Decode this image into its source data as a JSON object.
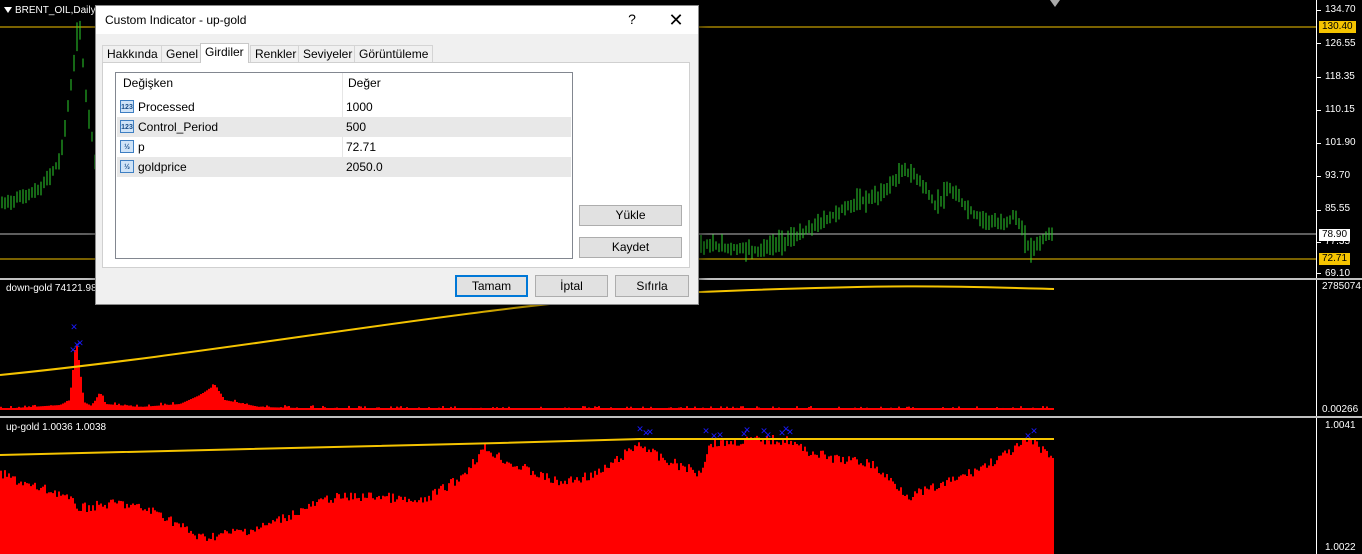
{
  "chart": {
    "symbol_label": "BRENT_OIL,Daily",
    "price_scale": [
      "134.70",
      "126.55",
      "118.35",
      "110.15",
      "101.90",
      "93.70",
      "85.55",
      "77.35",
      "69.10"
    ],
    "price_tags": {
      "top_line": "130.40",
      "current": "78.90",
      "gold_line": "72.71"
    },
    "colors": {
      "candles": "#2bd12b",
      "histogram": "#ff0000",
      "trend": "#f5c400",
      "markers": "#1a1aff",
      "hline": "#f5c400",
      "background": "#000000"
    }
  },
  "down_pane": {
    "title": "down-gold 74121.982",
    "scale_top": "2785074",
    "scale_bottom": "0.00266"
  },
  "up_pane": {
    "title": "up-gold 1.0036 1.0038",
    "scale_top": "1.0041",
    "scale_bottom": "1.0022"
  },
  "dialog": {
    "title": "Custom Indicator - up-gold",
    "help": "?",
    "close": "✕",
    "tabs": [
      "Hakkında",
      "Genel",
      "Girdiler",
      "Renkler",
      "Seviyeler",
      "Görüntüleme"
    ],
    "active_tab": "Girdiler",
    "grid": {
      "col_variable": "Değişken",
      "col_value": "Değer",
      "rows": [
        {
          "icon": "123",
          "name": "Processed",
          "value": "1000"
        },
        {
          "icon": "123",
          "name": "Control_Period",
          "value": "500"
        },
        {
          "icon": "½",
          "name": "p",
          "value": "72.71"
        },
        {
          "icon": "½",
          "name": "goldprice",
          "value": "2050.0"
        }
      ]
    },
    "side_buttons": {
      "load": "Yükle",
      "save": "Kaydet"
    },
    "footer_buttons": {
      "ok": "Tamam",
      "cancel": "İptal",
      "reset": "Sıfırla"
    }
  }
}
